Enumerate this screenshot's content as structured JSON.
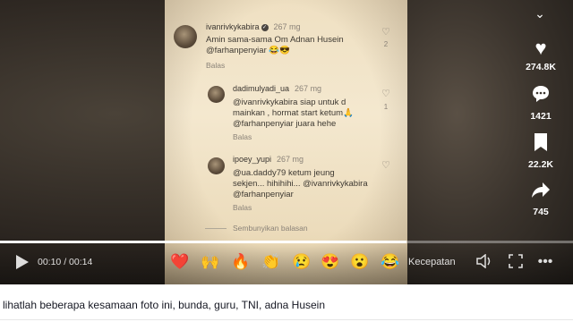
{
  "comments": [
    {
      "username": "ivanrivkykabira",
      "time": "267 mg",
      "verified": true,
      "text_lines": [
        "Amin sama-sama Om Adnan Husein",
        "@farhanpenyiar 😂😎"
      ],
      "reply": "Balas",
      "likes": "2"
    },
    {
      "username": "dadimulyadi_ua",
      "time": "267 mg",
      "text_lines": [
        "@ivanrivkykabira siap untuk d",
        "mainkan , hormat start ketum🙏",
        "@farhanpenyiar juara hehe"
      ],
      "reply": "Balas",
      "likes": "1"
    },
    {
      "username": "ipoey_yupi",
      "time": "267 mg",
      "text_lines": [
        "@ua.daddy79 ketum jeung",
        "sekjen... hihihihi... @ivanrivkykabira",
        "@farhanpenyiar"
      ],
      "reply": "Balas",
      "likes": ""
    }
  ],
  "hide_replies": "Sembunyikan balasan",
  "sidebar": {
    "likes": "274.8K",
    "comments": "1421",
    "saves": "22.2K",
    "shares": "745"
  },
  "player": {
    "time": "00:10 / 00:14",
    "speed_label": "Kecepatan",
    "progress": 0.71,
    "reactions": [
      "❤️",
      "🙌",
      "🔥",
      "👏",
      "😢",
      "😍",
      "😮",
      "😂"
    ]
  },
  "caption": "lihatlah beberapa kesamaan foto ini, bunda, guru, TNI, adna Husein",
  "icons": {
    "chevron": "chevron-down-icon",
    "like": "heart-icon",
    "comment": "comment-icon",
    "save": "bookmark-icon",
    "share": "share-icon"
  }
}
